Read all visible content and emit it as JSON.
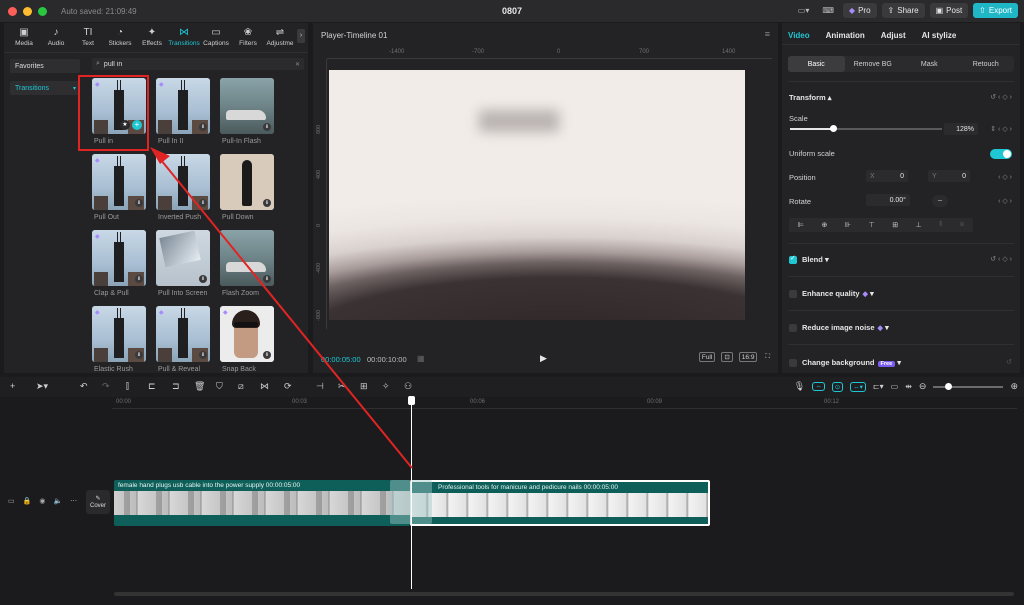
{
  "window": {
    "autosave": "Auto saved: 21:09:49",
    "title": "0807",
    "pro_label": "Pro",
    "share_label": "Share",
    "post_label": "Post",
    "export_label": "Export"
  },
  "media_tabs": [
    {
      "label": "Media",
      "icon": "▣"
    },
    {
      "label": "Audio",
      "icon": "♪"
    },
    {
      "label": "Text",
      "icon": "TI"
    },
    {
      "label": "Stickers",
      "icon": "◔"
    },
    {
      "label": "Effects",
      "icon": "✦"
    },
    {
      "label": "Transitions",
      "icon": "⋈"
    },
    {
      "label": "Captions",
      "icon": "▭"
    },
    {
      "label": "Filters",
      "icon": "❀"
    },
    {
      "label": "Adjustme",
      "icon": "⇌"
    }
  ],
  "sidebar": {
    "favorites": "Favorites",
    "transitions": "Transitions"
  },
  "search": {
    "value": "pull in"
  },
  "transitions": [
    {
      "label": "Pull in",
      "scene": "tower"
    },
    {
      "label": "Pull In II",
      "scene": "tower"
    },
    {
      "label": "Pull-In Flash",
      "scene": "car"
    },
    {
      "label": "Pull Out",
      "scene": "tower"
    },
    {
      "label": "Inverted Push",
      "scene": "tower"
    },
    {
      "label": "Pull Down",
      "scene": "person"
    },
    {
      "label": "Clap & Pull",
      "scene": "tower"
    },
    {
      "label": "Pull Into Screen",
      "scene": "mountain"
    },
    {
      "label": "Flash Zoom",
      "scene": "car"
    },
    {
      "label": "Elastic Rush",
      "scene": "tower"
    },
    {
      "label": "Pull & Reveal",
      "scene": "tower"
    },
    {
      "label": "Snap Back",
      "scene": "face"
    }
  ],
  "player": {
    "title": "Player-Timeline 01",
    "ruler_x": [
      "-1400",
      "-700",
      "0",
      "700",
      "1400"
    ],
    "ruler_y": [
      "800",
      "400",
      "0",
      "-400",
      "-800"
    ],
    "current_time": "00:00:05:00",
    "total_time": "00:00:10:00",
    "full_label": "Full",
    "ratio_label": "16:9"
  },
  "properties": {
    "tabs": [
      "Video",
      "Animation",
      "Adjust",
      "AI stylize"
    ],
    "subtabs": [
      "Basic",
      "Remove BG",
      "Mask",
      "Retouch"
    ],
    "transform_label": "Transform",
    "scale_label": "Scale",
    "scale_value": "128%",
    "scale_fraction": 0.28,
    "uniform_scale_label": "Uniform scale",
    "position_label": "Position",
    "pos_x_label": "X",
    "pos_x": "0",
    "pos_y_label": "Y",
    "pos_y": "0",
    "rotate_label": "Rotate",
    "rotate_value": "0.00°",
    "blend_label": "Blend",
    "enhance_label": "Enhance quality",
    "reduce_noise_label": "Reduce image noise",
    "change_bg_label": "Change background",
    "free_badge": "Free"
  },
  "timeline": {
    "ruler": [
      "00:00",
      "00:03",
      "00:06",
      "00:09",
      "00:12"
    ],
    "cover_label": "Cover",
    "clip1_title": "female hand plugs usb cable into the power supply   00:00:05:00",
    "clip2_title": "Professional tools for manicure and pedicure nails   00:00:05:00"
  },
  "colors": {
    "accent": "#1fc7d4",
    "highlight": "#e02424",
    "clip": "#0e5f5a"
  }
}
